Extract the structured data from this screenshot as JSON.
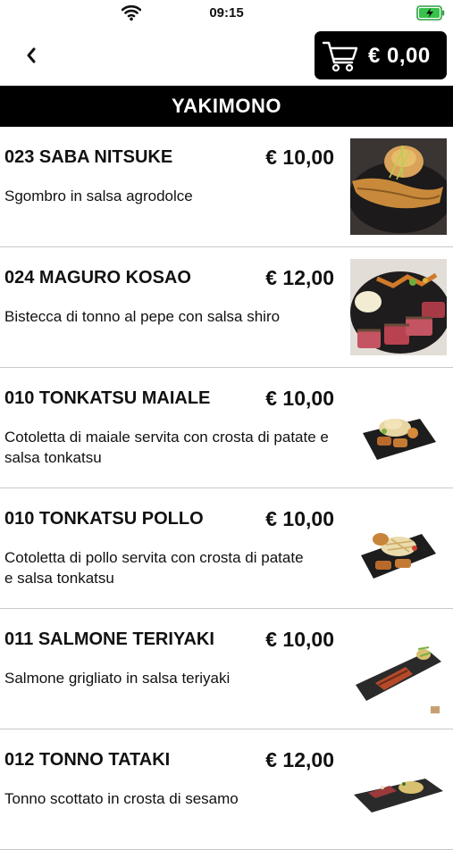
{
  "status_bar": {
    "time": "09:15"
  },
  "cart": {
    "total": "€ 0,00"
  },
  "section": {
    "title": "YAKIMONO"
  },
  "items": [
    {
      "name": "023 SABA NITSUKE",
      "price": "€ 10,00",
      "description": "Sgombro in salsa agrodolce"
    },
    {
      "name": "024 MAGURO KOSAO",
      "price": "€ 12,00",
      "description": "Bistecca di tonno al pepe con salsa shiro"
    },
    {
      "name": "010 TONKATSU MAIALE",
      "price": "€ 10,00",
      "description": "Cotoletta di maiale servita con crosta di patate e salsa tonkatsu"
    },
    {
      "name": "010 TONKATSU POLLO",
      "price": "€ 10,00",
      "description": "Cotoletta di pollo servita con crosta di patate\n e salsa tonkatsu"
    },
    {
      "name": "011 SALMONE TERIYAKI",
      "price": "€ 10,00",
      "description": "Salmone grigliato in salsa teriyaki"
    },
    {
      "name": "012 TONNO TATAKI",
      "price": "€ 12,00",
      "description": "Tonno scottato in crosta di sesamo"
    }
  ]
}
